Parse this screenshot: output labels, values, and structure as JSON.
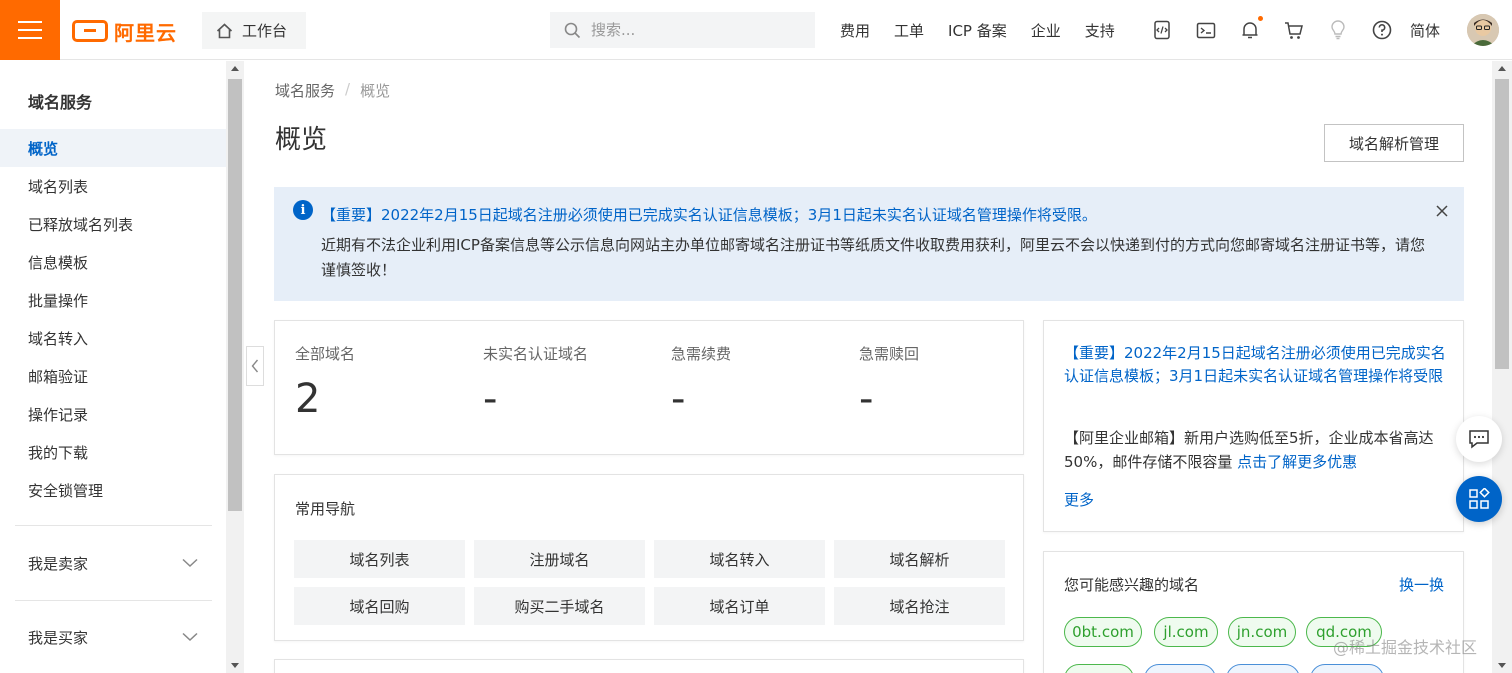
{
  "topbar": {
    "logo_text": "阿里云",
    "workbench_label": "工作台",
    "search_placeholder": "搜索...",
    "links": [
      "费用",
      "工单",
      "ICP 备案",
      "企业",
      "支持"
    ],
    "icons": [
      "code-icon",
      "terminal-icon",
      "bell-icon",
      "cart-icon",
      "lightbulb-icon",
      "help-icon"
    ],
    "language": "简体"
  },
  "sidebar": {
    "title": "域名服务",
    "items": [
      {
        "label": "概览",
        "active": true
      },
      {
        "label": "域名列表"
      },
      {
        "label": "已释放域名列表"
      },
      {
        "label": "信息模板"
      },
      {
        "label": "批量操作"
      },
      {
        "label": "域名转入"
      },
      {
        "label": "邮箱验证"
      },
      {
        "label": "操作记录"
      },
      {
        "label": "我的下载"
      },
      {
        "label": "安全锁管理"
      }
    ],
    "groups": [
      {
        "label": "我是卖家"
      },
      {
        "label": "我是买家"
      }
    ]
  },
  "main": {
    "breadcrumb": [
      "域名服务",
      "/",
      "概览"
    ],
    "page_title": "概览",
    "dns_button": "域名解析管理",
    "notice": {
      "title": "【重要】2022年2月15日起域名注册必须使用已完成实名认证信息模板；3月1日起未实名认证域名管理操作将受限。",
      "body": "近期有不法企业利用ICP备案信息等公示信息向网站主办单位邮寄域名注册证书等纸质文件收取费用获利，阿里云不会以快递到付的方式向您邮寄域名注册证书等，请您谨慎签收！"
    },
    "stats": [
      {
        "label": "全部域名",
        "value": "2"
      },
      {
        "label": "未实名认证域名",
        "value": "-"
      },
      {
        "label": "急需续费",
        "value": "-"
      },
      {
        "label": "急需赎回",
        "value": "-"
      }
    ],
    "quick_nav": {
      "title": "常用导航",
      "buttons": [
        "域名列表",
        "注册域名",
        "域名转入",
        "域名解析",
        "域名回购",
        "购买二手域名",
        "域名订单",
        "域名抢注"
      ]
    },
    "news": {
      "title": "【重要】2022年2月15日起域名注册必须使用已完成实名认证信息模板；3月1日起未实名认证域名管理操作将受限",
      "ad_text": "【阿里企业邮箱】新用户选购低至5折，企业成本省高达50%，邮件存储不限容量",
      "ad_link": "点击了解更多优惠",
      "more": "更多"
    },
    "domains": {
      "title": "您可能感兴趣的域名",
      "refresh": "换一换",
      "tags": [
        "0bt.com",
        "jl.com",
        "jn.com",
        "qd.com"
      ]
    }
  },
  "watermark": "@稀土掘金技术社区",
  "colors": {
    "brand": "#ff6a00",
    "link": "#0064c8",
    "notice_bg": "#e6eef8",
    "tag_green": "#2ea02e"
  }
}
